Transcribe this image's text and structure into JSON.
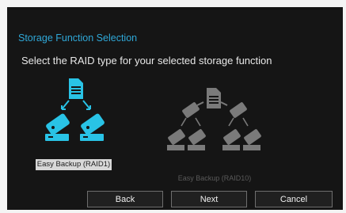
{
  "dialog": {
    "title": "Storage Function Selection",
    "prompt": "Select the RAID type for your selected storage function"
  },
  "options": [
    {
      "label": "Easy Backup (RAID1)",
      "selected": true,
      "icon": "raid1-diagram-icon"
    },
    {
      "label": "Easy Backup (RAID10)",
      "selected": false,
      "icon": "raid10-diagram-icon"
    }
  ],
  "buttons": {
    "back": "Back",
    "next": "Next",
    "cancel": "Cancel"
  },
  "colors": {
    "accent": "#2fa8d8",
    "raid_active": "#29c3e6",
    "raid_inactive": "#7a7a7a",
    "background": "#151515"
  }
}
